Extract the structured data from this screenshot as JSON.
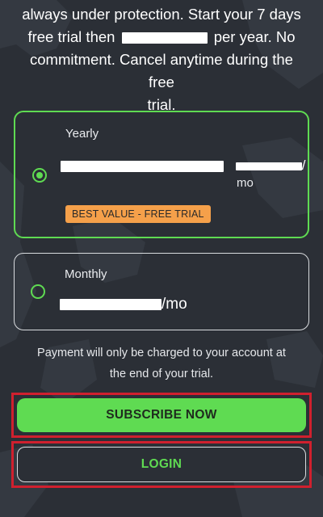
{
  "intro": {
    "line1": "always under protection. Start your 7 days",
    "line2_prefix": "free trial then",
    "line2_suffix": "per year. No",
    "line3": "commitment. Cancel anytime during the free",
    "line4": "trial."
  },
  "plans": [
    {
      "name": "Yearly",
      "price_suffix": "/",
      "unit": "mo",
      "badge": "BEST VALUE - FREE TRIAL",
      "selected": true
    },
    {
      "name": "Monthly",
      "price_suffix": "/mo",
      "selected": false
    }
  ],
  "charge_note": {
    "line1": "Payment will only be charged to your account at",
    "line2": "the end of your trial."
  },
  "buttons": {
    "subscribe": "SUBSCRIBE NOW",
    "login": "LOGIN"
  },
  "colors": {
    "background": "#2b2f36",
    "accent_green": "#5fdb52",
    "badge_orange": "#f5a04a",
    "highlight_red": "#d0202e"
  }
}
